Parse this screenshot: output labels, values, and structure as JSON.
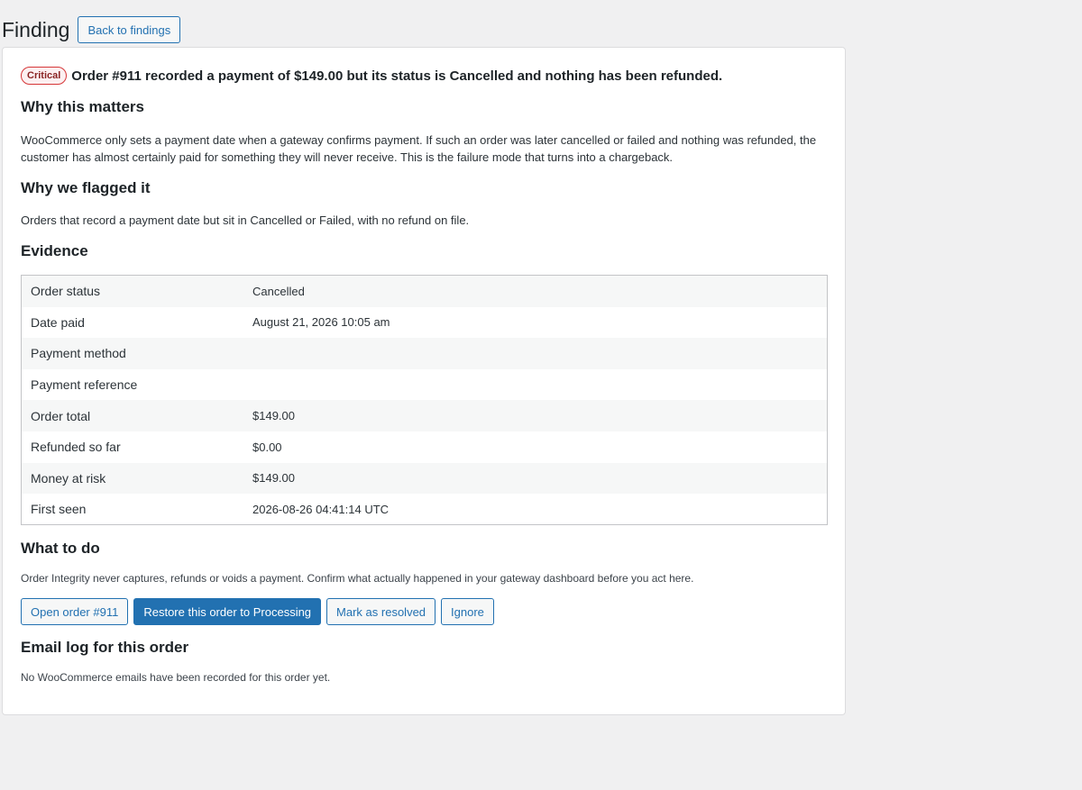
{
  "page": {
    "title": "Finding",
    "back_label": "Back to findings"
  },
  "finding": {
    "severity": "Critical",
    "headline": "Order #911 recorded a payment of $149.00 but its status is Cancelled and nothing has been refunded."
  },
  "sections": {
    "why_matters": {
      "heading": "Why this matters",
      "body": "WooCommerce only sets a payment date when a gateway confirms payment. If such an order was later cancelled or failed and nothing was refunded, the customer has almost certainly paid for something they will never receive. This is the failure mode that turns into a chargeback."
    },
    "why_flagged": {
      "heading": "Why we flagged it",
      "body": "Orders that record a payment date but sit in Cancelled or Failed, with no refund on file."
    },
    "evidence": {
      "heading": "Evidence",
      "rows": [
        {
          "label": "Order status",
          "value": "Cancelled"
        },
        {
          "label": "Date paid",
          "value": "August 21, 2026 10:05 am"
        },
        {
          "label": "Payment method",
          "value": ""
        },
        {
          "label": "Payment reference",
          "value": ""
        },
        {
          "label": "Order total",
          "value": "$149.00"
        },
        {
          "label": "Refunded so far",
          "value": "$0.00"
        },
        {
          "label": "Money at risk",
          "value": "$149.00"
        },
        {
          "label": "First seen",
          "value": "2026-08-26 04:41:14 UTC"
        }
      ]
    },
    "what_to_do": {
      "heading": "What to do",
      "body": "Order Integrity never captures, refunds or voids a payment. Confirm what actually happened in your gateway dashboard before you act here.",
      "actions": {
        "open_order": "Open order #911",
        "restore": "Restore this order to Processing",
        "mark_resolved": "Mark as resolved",
        "ignore": "Ignore"
      }
    },
    "email_log": {
      "heading": "Email log for this order",
      "body": "No WooCommerce emails have been recorded for this order yet."
    }
  },
  "colors": {
    "primary": "#2271b1",
    "critical": "#d63638",
    "background": "#f0f0f1"
  }
}
